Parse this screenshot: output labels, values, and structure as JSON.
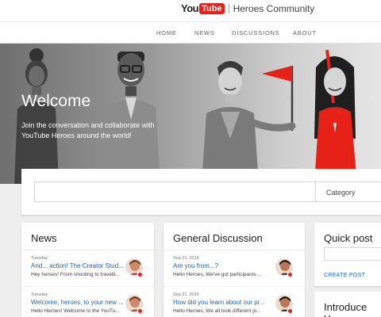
{
  "header": {
    "logo_you": "You",
    "logo_tube": "Tube",
    "community": "Heroes Community"
  },
  "nav": {
    "home": "HOME",
    "news": "NEWS",
    "discussions": "DISCUSSIONS",
    "about": "ABOUT"
  },
  "hero": {
    "title": "Welcome",
    "subtitle": "Join the conversation and collaborate with YouTube Heroes around the world!"
  },
  "search": {
    "placeholder": "",
    "category_label": "Category"
  },
  "news": {
    "title": "News",
    "posts": [
      {
        "date": "Tuesday",
        "title": "And... action! The Creator Stud...",
        "text": "Hey heroes! From shooting to travelli..."
      },
      {
        "date": "Tuesday",
        "title": "Welcome, heroes, to your new ...",
        "text": "Hello Heroes! Welcome to the YouTu..."
      }
    ]
  },
  "discussion": {
    "title": "General Discussion",
    "posts": [
      {
        "date": "Sep 21, 2016",
        "title": "Are you from...?",
        "text": "Hello Heroes, We've got participants ..."
      },
      {
        "date": "Sep 21, 2016",
        "title": "How did you learn about our pr...",
        "text": "Hello Heroes, We all took different jo..."
      }
    ]
  },
  "quick_post": {
    "title": "Quick post",
    "create_label": "CREATE POST"
  },
  "introduce": {
    "title": "Introduce Yo"
  },
  "colors": {
    "brand_red": "#e62117",
    "link_blue": "#1565c0"
  }
}
